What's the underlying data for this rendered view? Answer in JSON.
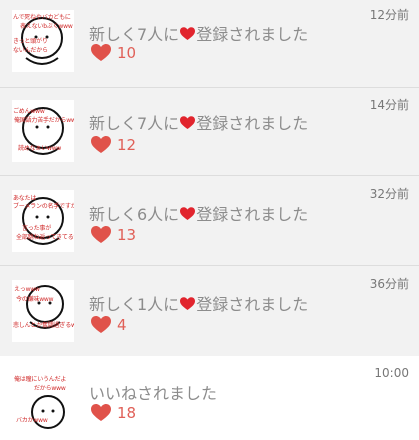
{
  "notifications": [
    {
      "message_before": "新しく7人に",
      "message_after": "登録されました",
      "time": "12分前",
      "likes": "10",
      "thumb_captions": [
        "んで死ねやバカどもに",
        "表えないbぶくwww",
        "きっと頭がり",
        "ないんだから"
      ]
    },
    {
      "message_before": "新しく7人に",
      "message_after": "登録されました",
      "time": "14分前",
      "likes": "12",
      "thumb_captions": [
        "ごめんwww",
        "俺国語力苦手だからwww",
        "読めなぁいwww"
      ]
    },
    {
      "message_before": "新しく6人に",
      "message_after": "登録されました",
      "time": "32分前",
      "likes": "13",
      "thumb_captions": [
        "あなたは",
        "ブーメランの名手ですかwww",
        "言った事が",
        "全部跳ね返ってきてるwww"
      ]
    },
    {
      "message_before": "新しく1人に",
      "message_after": "登録されました",
      "time": "36分前",
      "likes": "4",
      "thumb_captions": [
        "えっwww",
        "今の嫌味www",
        "悲しんとか奮闘過ぎるww"
      ]
    },
    {
      "message_before": "いいねされました",
      "message_after": "",
      "time": "10:00",
      "likes": "18",
      "thumb_captions": [
        "俺は瞳にいうんだよ",
        "だからwww",
        "バカかwww"
      ]
    }
  ],
  "colors": {
    "heart": "#e0524a",
    "inline_heart": "#e1242d",
    "count": "#e06058",
    "message": "#8c8c8c",
    "time": "#777777",
    "thumb_caption": "#d02b2b"
  },
  "icons": {
    "like": "heart-icon",
    "registered": "red-heart-emoji-icon"
  }
}
